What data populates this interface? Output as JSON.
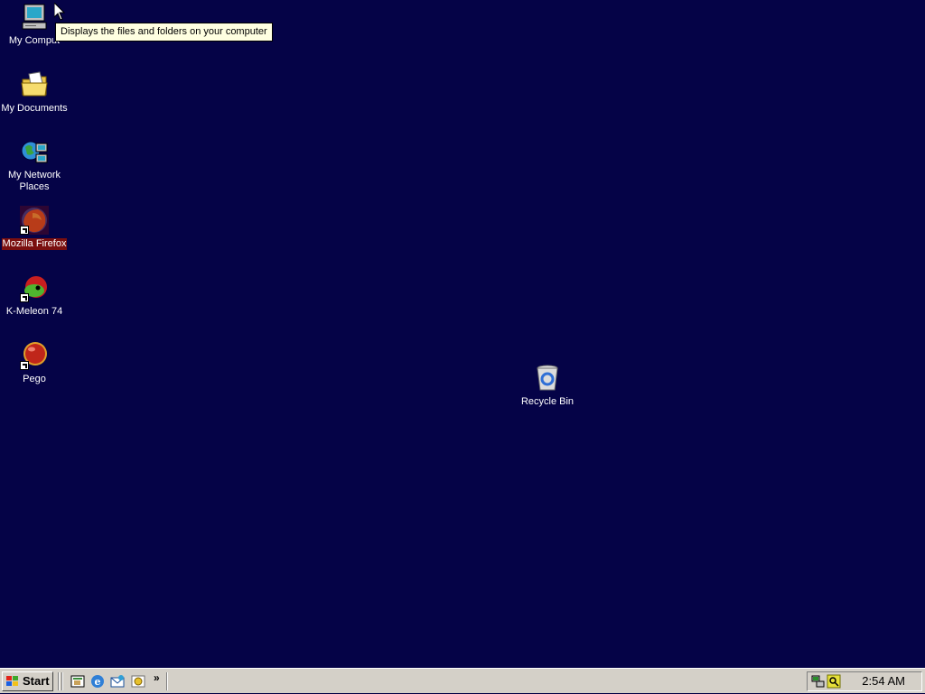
{
  "desktop": {
    "icons": [
      {
        "label": "My Comput"
      },
      {
        "label": "My Documents"
      },
      {
        "label": "My Network Places"
      },
      {
        "label": "Mozilla Firefox"
      },
      {
        "label": "K-Meleon 74"
      },
      {
        "label": "Pego"
      },
      {
        "label": "Recycle Bin"
      }
    ],
    "tooltip": "Displays the files and folders on your computer"
  },
  "taskbar": {
    "start_label": "Start",
    "chevron": "»",
    "clock": "2:54 AM"
  }
}
